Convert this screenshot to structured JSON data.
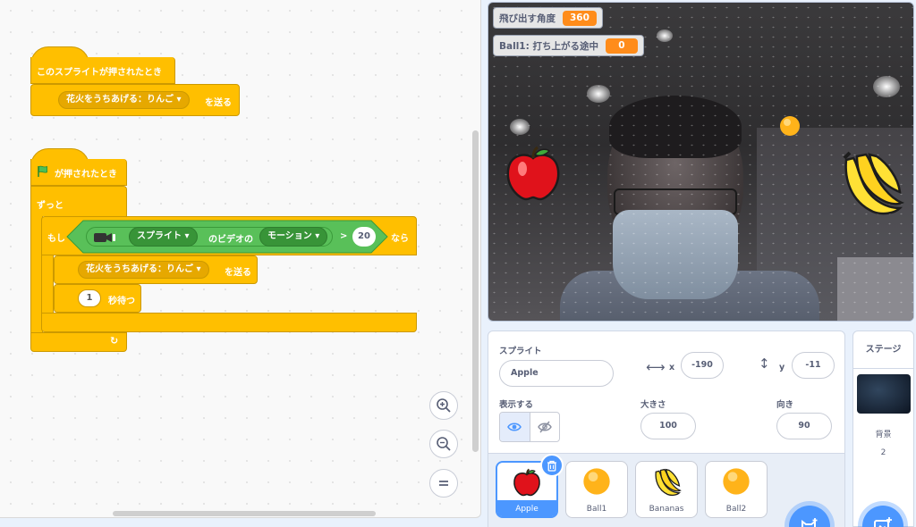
{
  "code": {
    "script1": {
      "hat_label": "このスプライトが押されたとき",
      "broadcast_block": {
        "dropdown": "花火をうちあげる：りんご",
        "suffix": "を送る"
      }
    },
    "script2": {
      "hat_label": "が押されたとき",
      "forever_label": "ずっと",
      "if_label": "もし",
      "then_label": "なら",
      "video_sensing": {
        "target": "スプライト",
        "of_label": "のビデオの",
        "attribute": "モーション"
      },
      "operator": ">",
      "compare_value": "20",
      "broadcast_block": {
        "dropdown": "花火をうちあげる：りんご",
        "suffix": "を送る"
      },
      "wait_block": {
        "value": "1",
        "suffix": "秒待つ"
      }
    }
  },
  "zoom_controls": [
    "zoom-in",
    "zoom-out",
    "zoom-reset"
  ],
  "stage": {
    "monitors": [
      {
        "label": "飛び出す角度",
        "value": "360"
      },
      {
        "label": "Ball1: 打ち上がる途中",
        "value": "0"
      }
    ]
  },
  "sprite_info": {
    "sprite_label": "スプライト",
    "name_value": "Apple",
    "x_label": "x",
    "x_value": "-190",
    "y_label": "y",
    "y_value": "-11",
    "show_label": "表示する",
    "size_label": "大きさ",
    "size_value": "100",
    "direction_label": "向き",
    "direction_value": "90"
  },
  "sprites": [
    {
      "name": "Apple",
      "icon": "apple-icon",
      "selected": true
    },
    {
      "name": "Ball1",
      "icon": "ball-icon",
      "selected": false
    },
    {
      "name": "Bananas",
      "icon": "bananas-icon",
      "selected": false
    },
    {
      "name": "Ball2",
      "icon": "ball-icon",
      "selected": false
    }
  ],
  "stage_panel": {
    "title": "ステージ",
    "backdrop_label": "背景",
    "backdrop_count": "2"
  },
  "colors": {
    "events": "#ffbf00",
    "extension": "#59c059",
    "monitor_value": "#ff8c1a",
    "accent": "#4c97ff"
  }
}
